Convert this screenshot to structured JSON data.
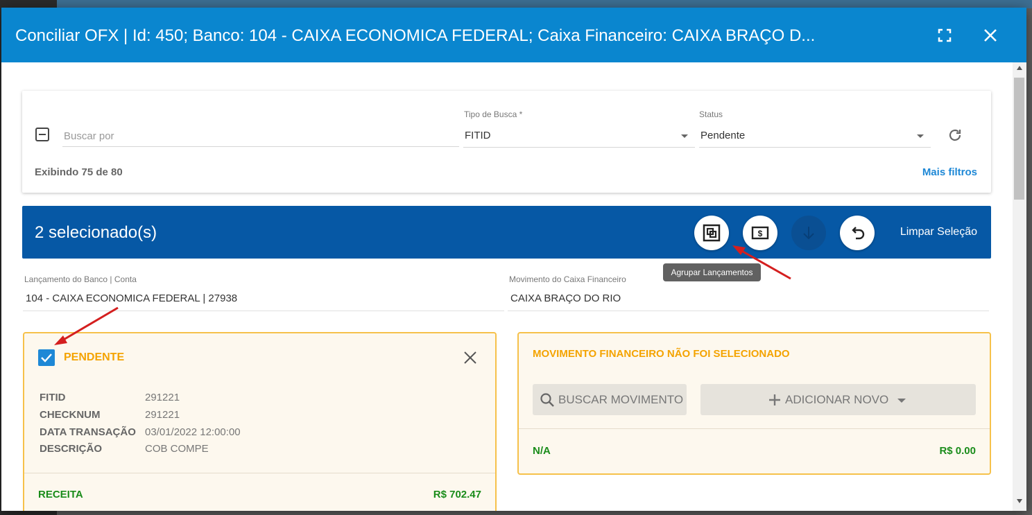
{
  "dialog": {
    "title": "Conciliar OFX | Id: 450; Banco: 104 - CAIXA ECONOMICA FEDERAL; Caixa Financeiro: CAIXA BRAÇO D..."
  },
  "filters": {
    "search_placeholder": "Buscar por",
    "search_value": "",
    "search_type_label": "Tipo de Busca *",
    "search_type_value": "FITID",
    "status_label": "Status",
    "status_value": "Pendente",
    "showing_text": "Exibindo 75 de 80",
    "more_filters_label": "Mais filtros"
  },
  "selection_bar": {
    "count_text": "2 selecionado(s)",
    "clear_label": "Limpar Seleção",
    "tooltip": "Agrupar Lançamentos"
  },
  "columns": {
    "bank_label": "Lançamento do Banco | Conta",
    "bank_value": "104 - CAIXA ECONOMICA FEDERAL | 27938",
    "cash_label": "Movimento do Caixa Financeiro",
    "cash_value": "CAIXA BRAÇO DO RIO"
  },
  "bank_entry": {
    "checked": true,
    "status": "PENDENTE",
    "fields": [
      {
        "key": "FITID",
        "value": "291221"
      },
      {
        "key": "CHECKNUM",
        "value": "291221"
      },
      {
        "key": "DATA TRANSAÇÃO",
        "value": "03/01/2022 12:00:00"
      },
      {
        "key": "DESCRIÇÃO",
        "value": "COB COMPE"
      }
    ],
    "type": "RECEITA",
    "amount": "R$ 702.47"
  },
  "cash_entry": {
    "message": "MOVIMENTO FINANCEIRO NÃO FOI SELECIONADO",
    "search_button": "BUSCAR MOVIMENTO",
    "add_button": "ADICIONAR NOVO",
    "na_label": "N/A",
    "amount": "R$ 0.00"
  },
  "colors": {
    "title_bar": "#0a86cf",
    "selection_bar": "#0658a5",
    "accent_orange": "#f4a300",
    "green": "#1a8c1a",
    "link_blue": "#1e88d6"
  },
  "icons": [
    "fullscreen-icon",
    "close-icon",
    "deselect-icon",
    "refresh-icon",
    "group-entries-icon",
    "money-icon",
    "arrow-down-icon",
    "undo-icon",
    "check-icon",
    "search-icon",
    "plus-icon",
    "caret-down-icon",
    "annotation-arrow"
  ]
}
